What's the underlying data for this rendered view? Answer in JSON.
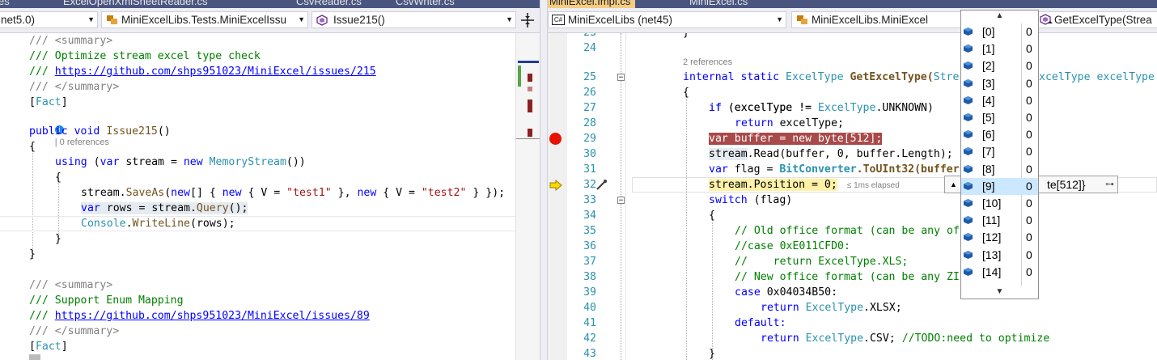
{
  "tabs": [
    {
      "label": "es",
      "active": false
    },
    {
      "label": "ExcelOpenXmlSheetReader.cs",
      "active": false
    },
    {
      "label": "CsvReader.cs",
      "active": false
    },
    {
      "label": "CsvWriter.cs",
      "active": false
    },
    {
      "label": "MiniExcel.Impl.cs",
      "active": true
    },
    {
      "label": "MiniExcel.cs",
      "active": false
    }
  ],
  "left_nav": {
    "framework": "net5.0)",
    "class": "MiniExcelLibs.Tests.MiniExcelIssu",
    "member": "Issue215()"
  },
  "right_nav": {
    "project": "MiniExcelLibs (net45)",
    "class": "MiniExcelLibs.MiniExcel",
    "member": "GetExcelType(Strea"
  },
  "left_code": {
    "lines": [
      [
        "/// <summary>"
      ],
      [
        "/// Optimize stream excel type check"
      ],
      [
        "/// ",
        "https://github.com/shps951023/MiniExcel/issues/215"
      ],
      [
        "/// </summary>"
      ],
      [
        "[Fact]"
      ],
      [
        "| 0 references"
      ],
      [
        "public void Issue215()"
      ],
      [
        "{"
      ],
      [
        "using (var stream = new MemoryStream())"
      ],
      [
        "{"
      ],
      [
        "stream.SaveAs(new[] { new { V = \"test1\" }, new { V = \"test2\" } });"
      ],
      [
        "var rows = stream.Query();"
      ],
      [
        "Console.WriteLine(rows);"
      ],
      [
        "}"
      ],
      [
        "}"
      ],
      [
        ""
      ],
      [
        "/// <summary>"
      ],
      [
        "/// Support Enum Mapping"
      ],
      [
        "/// ",
        "https://github.com/shps951023/MiniExcel/issues/89"
      ],
      [
        "/// </summary>"
      ],
      [
        "[Fact]"
      ]
    ]
  },
  "right_code": {
    "line_numbers": [
      "23",
      "24",
      "",
      "25",
      "26",
      "27",
      "28",
      "29",
      "30",
      "31",
      "32",
      "33",
      "34",
      "35",
      "36",
      "37",
      "38",
      "39",
      "40",
      "41",
      "42",
      "43"
    ],
    "lens": "2 references",
    "elapsed": "≤ 1ms elapsed",
    "text": {
      "l23": "}",
      "l25a": "internal static ",
      "l25b": "ExcelType",
      "l25c": " GetExcelType(",
      "l25d": "Stre",
      "l25e": "xcelType excelType",
      "l26": "{",
      "l27a": "if (excelType != ",
      "l27b": "ExcelType",
      "l27c": ".UNKNOWN)",
      "l28": "return excelType;",
      "l29": "var buffer = new byte[512];",
      "l30a": "stream",
      "l30b": ".Read(buffer, 0, buffer.Length);",
      "l31a": "var flag = ",
      "l31b": "BitConverter",
      "l31c": ".ToUInt32(buffer",
      "l32": "stream.Position = 0;",
      "l33": "switch (flag)",
      "l34": "{",
      "l35": "// Old office format (can be any of",
      "l36": "//case 0xE011CFD0:",
      "l37": "//    return ExcelType.XLS;",
      "l38": "// New office format (can be any ZI",
      "l39": "case 0x04034B50:",
      "l40a": "return ",
      "l40b": "ExcelType",
      "l40c": ".XLSX;",
      "l41": "default:",
      "l42a": "return ",
      "l42b": "ExcelType",
      "l42c": ".CSV; ",
      "l42d": "//TODO:need to optimize",
      "l43": "}"
    }
  },
  "datatip": {
    "tail": "te[512]}"
  },
  "array_popup": {
    "items": [
      {
        "index": "[0]",
        "value": "0"
      },
      {
        "index": "[1]",
        "value": "0"
      },
      {
        "index": "[2]",
        "value": "0"
      },
      {
        "index": "[3]",
        "value": "0"
      },
      {
        "index": "[4]",
        "value": "0"
      },
      {
        "index": "[5]",
        "value": "0"
      },
      {
        "index": "[6]",
        "value": "0"
      },
      {
        "index": "[7]",
        "value": "0"
      },
      {
        "index": "[8]",
        "value": "0"
      },
      {
        "index": "[9]",
        "value": "0"
      },
      {
        "index": "[10]",
        "value": "0"
      },
      {
        "index": "[11]",
        "value": "0"
      },
      {
        "index": "[12]",
        "value": "0"
      },
      {
        "index": "[13]",
        "value": "0"
      },
      {
        "index": "[14]",
        "value": "0"
      }
    ],
    "highlighted_index": "[9]"
  },
  "colors": {
    "comment": "#008000",
    "keyword": "#0000ff",
    "type": "#2b91af",
    "breakpoint_line": "#a84a4a",
    "current_line": "#fff1a6",
    "active_tab": "#f5cc84"
  }
}
